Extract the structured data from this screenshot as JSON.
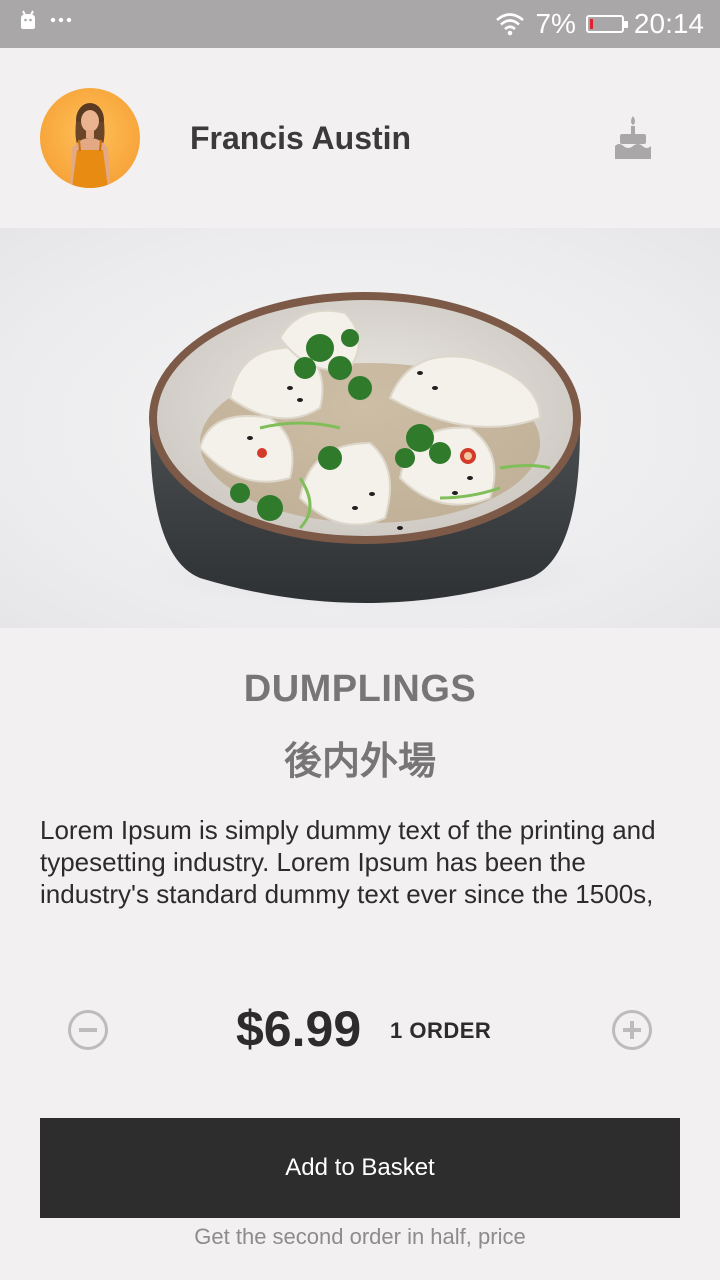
{
  "status_bar": {
    "left_icons": [
      "android-icon",
      "more-dots-icon"
    ],
    "battery_percent": "7%",
    "time": "20:14",
    "battery_level": 0.07,
    "battery_color": "#e0202a"
  },
  "header": {
    "user_name": "Francis Austin",
    "icons": [
      "avatar",
      "cake-icon"
    ]
  },
  "product": {
    "title": "DUMPLINGS",
    "subtitle": "後内外場",
    "description": "Lorem Ipsum is simply dummy text of the printing and typesetting industry. Lorem Ipsum has been the industry's standard dummy text ever since the 1500s,"
  },
  "order": {
    "price": "$6.99",
    "count_label": "1 ORDER",
    "minus_icon": "minus-circle-icon",
    "plus_icon": "plus-circle-icon"
  },
  "cta": {
    "add_label": "Add to Basket",
    "promo_text": "Get the second order in half, price"
  },
  "colors": {
    "background": "#f3f0f1",
    "status_bar": "#a9a7a8",
    "button": "#2e2d2d",
    "avatar_bg": "#f7a53a"
  }
}
